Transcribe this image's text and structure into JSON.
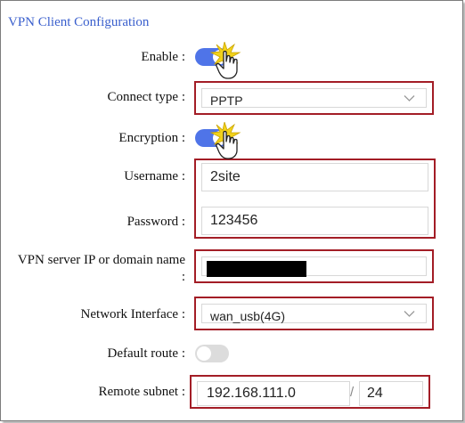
{
  "title": "VPN Client Configuration",
  "fields": {
    "enable": {
      "label": "Enable",
      "sep": ":",
      "value": true
    },
    "connect_type": {
      "label": "Connect type",
      "sep": ":",
      "value": "PPTP"
    },
    "encryption": {
      "label": "Encryption",
      "sep": ":",
      "value": true
    },
    "username": {
      "label": "Username",
      "sep": ":",
      "value": "2site"
    },
    "password": {
      "label": "Password",
      "sep": ":",
      "value": "123456"
    },
    "server": {
      "label": "VPN server IP or domain name",
      "sep": ":",
      "value": "redacted"
    },
    "network_interface": {
      "label": "Network Interface",
      "sep": ":",
      "value": "wan_usb(4G)"
    },
    "default_route": {
      "label": "Default route",
      "sep": ":",
      "value": false
    },
    "remote_subnet": {
      "label": "Remote subnet",
      "sep": ":",
      "ip": "192.168.111.0",
      "slash": "/",
      "mask": "24"
    }
  },
  "icons": {
    "dropdown": "chevron-down-icon",
    "click": "hand-pointer-icon"
  },
  "colors": {
    "title": "#3a5fcd",
    "toggle_on": "#4f74e8",
    "toggle_off": "#dcdcdc",
    "highlight_border": "#a31d26",
    "cursor_burst": "#f2d21b"
  }
}
